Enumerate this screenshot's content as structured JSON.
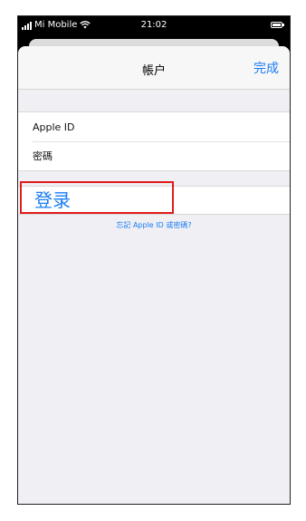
{
  "status_bar": {
    "carrier": "Mi Mobile",
    "time": "21:02"
  },
  "nav": {
    "title": "帳户",
    "done_label": "完成"
  },
  "form": {
    "apple_id_label": "Apple ID",
    "password_label": "密碼"
  },
  "login": {
    "label": "登录"
  },
  "forgot": {
    "label": "忘記 Apple ID 或密碼?"
  },
  "colors": {
    "accent": "#1a7cf5",
    "highlight": "#e01b1b",
    "background": "#efeff4"
  }
}
